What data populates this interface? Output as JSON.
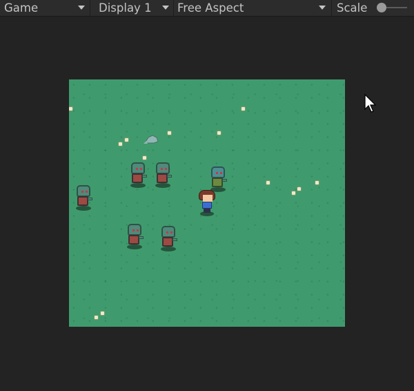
{
  "toolbar": {
    "view_mode": "Game",
    "display": "Display 1",
    "aspect": "Free Aspect",
    "scale_label": "Scale"
  },
  "colors": {
    "editor_background": "#232324",
    "toolbar_background": "#2c2c2d",
    "grass": "#3f9b6d"
  },
  "game": {
    "enemies": [
      "zombie",
      "zombie",
      "zombie",
      "zombie",
      "zombie",
      "zombie"
    ],
    "player": "player-character"
  }
}
